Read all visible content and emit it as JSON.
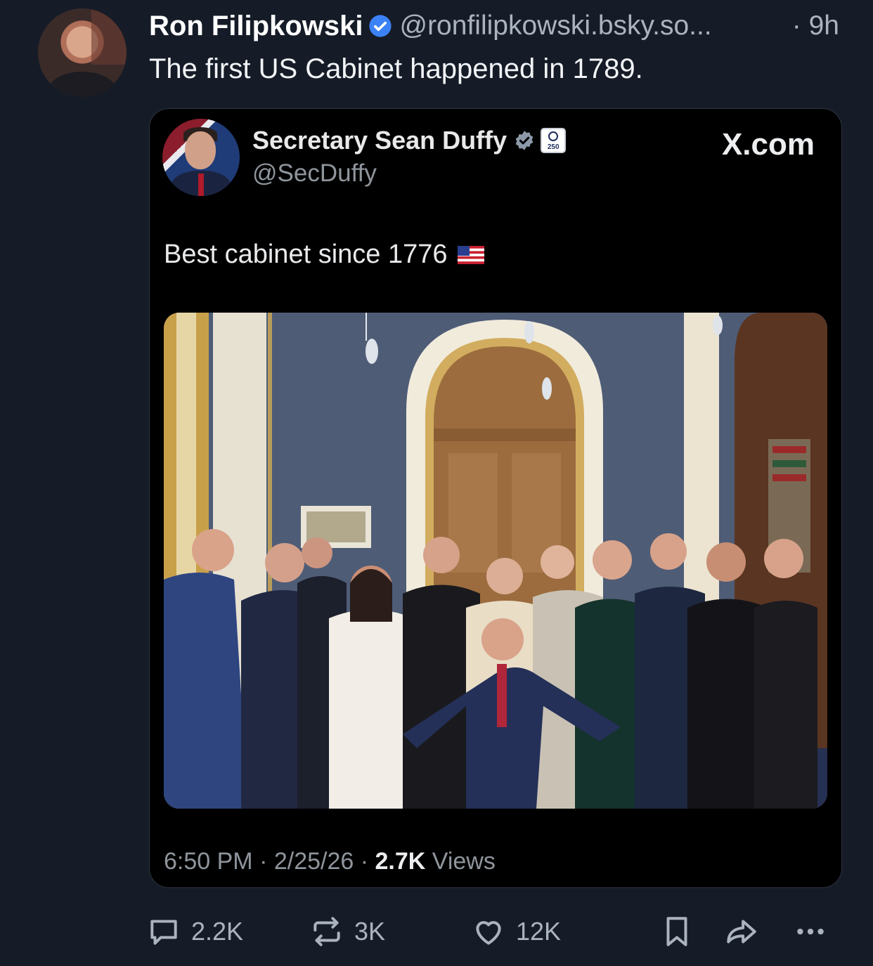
{
  "post": {
    "author_name": "Ron Filipkowski",
    "handle": "@ronfilipkowski.bsky.so...",
    "time": "· 9h",
    "text": "The first US Cabinet happened in 1789."
  },
  "embed": {
    "author_name": "Secretary Sean Duffy",
    "handle": "@SecDuffy",
    "affiliation_badge_text": "250",
    "source": "X.com",
    "text": "Best cabinet since 1776",
    "flag_emoji": "🇺🇸",
    "timestamp": "6:50 PM · 2/25/26 · ",
    "views_count": "2.7K",
    "views_label": " Views"
  },
  "actions": {
    "reply_count": "2.2K",
    "repost_count": "3K",
    "like_count": "12K"
  },
  "icons": {
    "verified": "verified-check-icon",
    "reply": "speech-bubble-icon",
    "repost": "repost-arrows-icon",
    "like": "heart-icon",
    "bookmark": "bookmark-icon",
    "share": "share-arrow-icon",
    "more": "ellipsis-icon"
  },
  "colors": {
    "background": "#161c27",
    "verified_blue": "#3b82f6",
    "muted_text": "#aab3bf"
  }
}
